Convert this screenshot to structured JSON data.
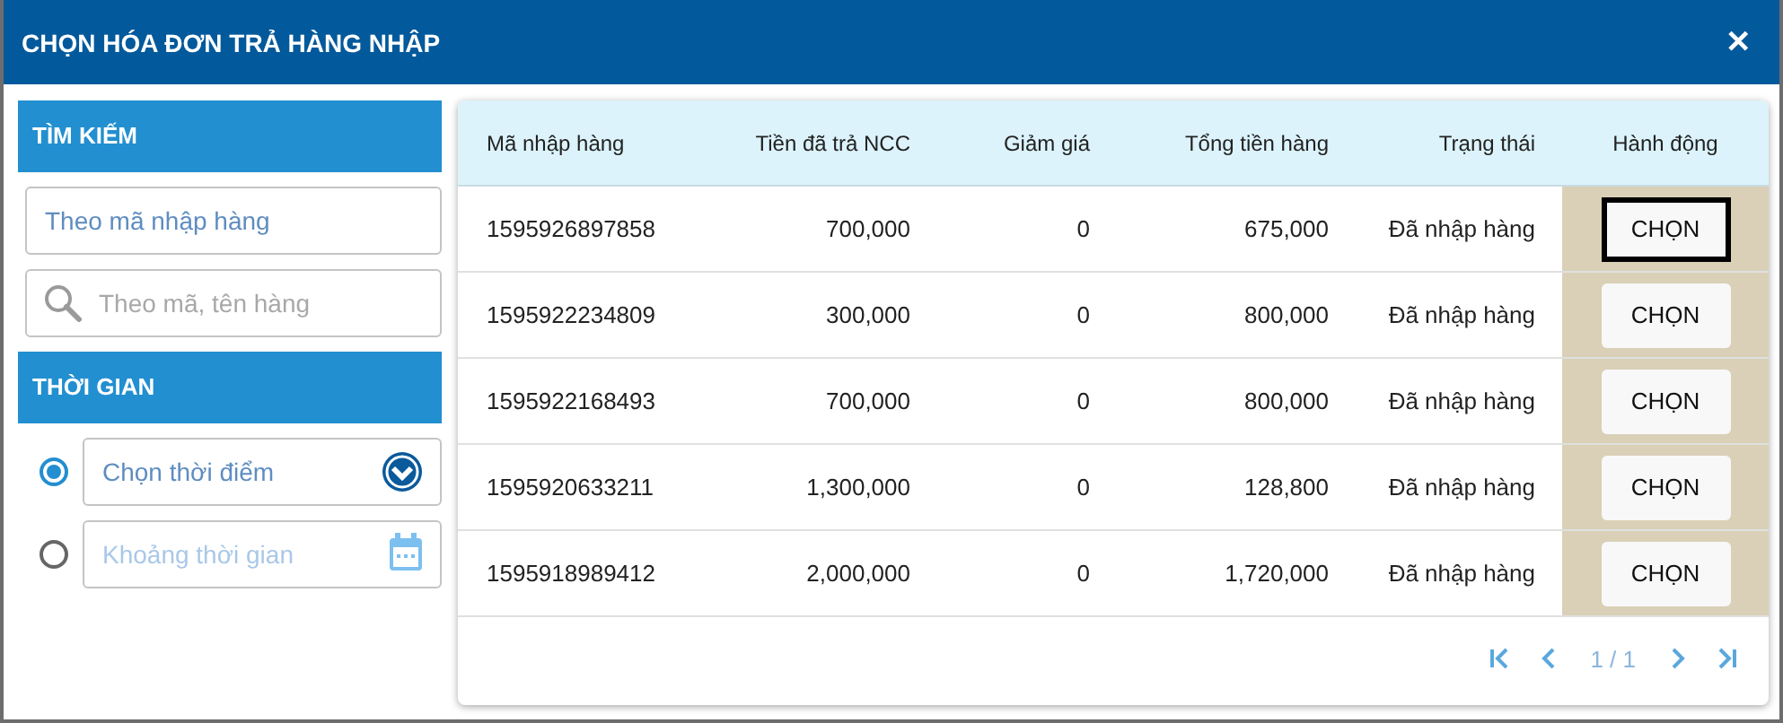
{
  "window": {
    "title": "CHỌN HÓA ĐƠN TRẢ HÀNG NHẬP",
    "close": "✕"
  },
  "search": {
    "heading": "TÌM KIẾM",
    "fields": [
      {
        "placeholder": "Theo mã nhập hàng",
        "kind": "plain"
      },
      {
        "placeholder": "Theo mã, tên hàng",
        "kind": "search"
      }
    ]
  },
  "time": {
    "heading": "THỜI GIAN",
    "options": [
      {
        "placeholder": "Chọn thời điểm",
        "selected": true,
        "kind": "dropdown"
      },
      {
        "placeholder": "Khoảng thời gian",
        "selected": false,
        "kind": "calendar"
      }
    ]
  },
  "table": {
    "columns": [
      "Mã nhập hàng",
      "Tiền đã trả NCC",
      "Giảm giá",
      "Tổng tiền hàng",
      "Trạng thái",
      "Hành động"
    ],
    "rows": [
      {
        "code": "1595926897858",
        "paid": "700,000",
        "discount": "0",
        "total": "675,000",
        "status": "Đã nhập hàng",
        "action": "CHỌN",
        "focused": true
      },
      {
        "code": "1595922234809",
        "paid": "300,000",
        "discount": "0",
        "total": "800,000",
        "status": "Đã nhập hàng",
        "action": "CHỌN",
        "focused": false
      },
      {
        "code": "1595922168493",
        "paid": "700,000",
        "discount": "0",
        "total": "800,000",
        "status": "Đã nhập hàng",
        "action": "CHỌN",
        "focused": false
      },
      {
        "code": "1595920633211",
        "paid": "1,300,000",
        "discount": "0",
        "total": "128,800",
        "status": "Đã nhập hàng",
        "action": "CHỌN",
        "focused": false
      },
      {
        "code": "1595918989412",
        "paid": "2,000,000",
        "discount": "0",
        "total": "1,720,000",
        "status": "Đã nhập hàng",
        "action": "CHỌN",
        "focused": false
      }
    ]
  },
  "pagination": {
    "page": "1 / 1"
  }
}
